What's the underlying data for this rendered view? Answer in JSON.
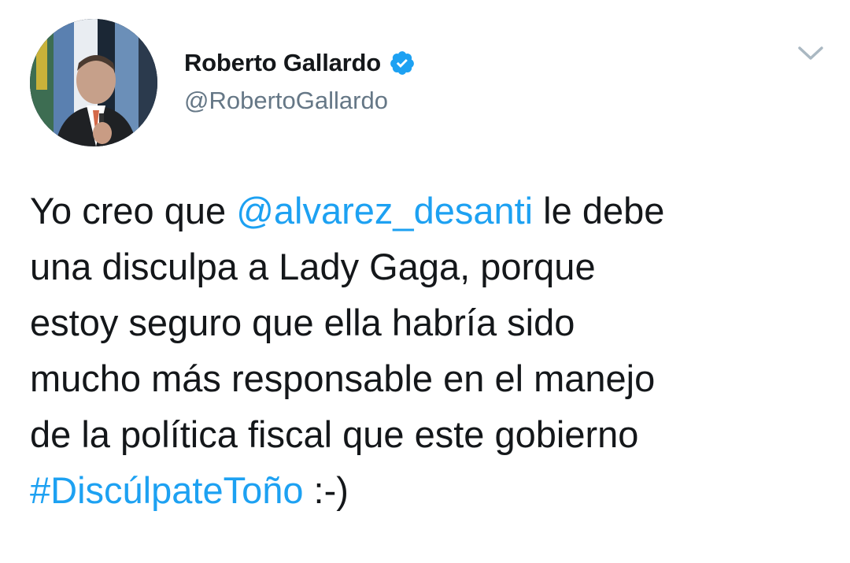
{
  "author": {
    "display_name": "Roberto Gallardo",
    "handle": "@RobertoGallardo",
    "verified": true,
    "avatar_icon": "profile-photo"
  },
  "tweet": {
    "line1_pre": "Yo creo que ",
    "mention": "@alvarez_desanti",
    "line1_post": " le debe",
    "line2": "una disculpa a Lady Gaga, porque",
    "line3": "estoy seguro que ella habría sido",
    "line4": "mucho más responsable en el manejo",
    "line5": "de la política fiscal que este gobierno",
    "hashtag": "#DiscúlpateToño",
    "tail": " :-)"
  },
  "icons": {
    "verified": "verified-badge-icon",
    "menu": "chevron-down-icon"
  },
  "colors": {
    "link": "#1da1f2",
    "text": "#14171a",
    "secondary": "#657786",
    "chevron": "#aab8c2"
  }
}
